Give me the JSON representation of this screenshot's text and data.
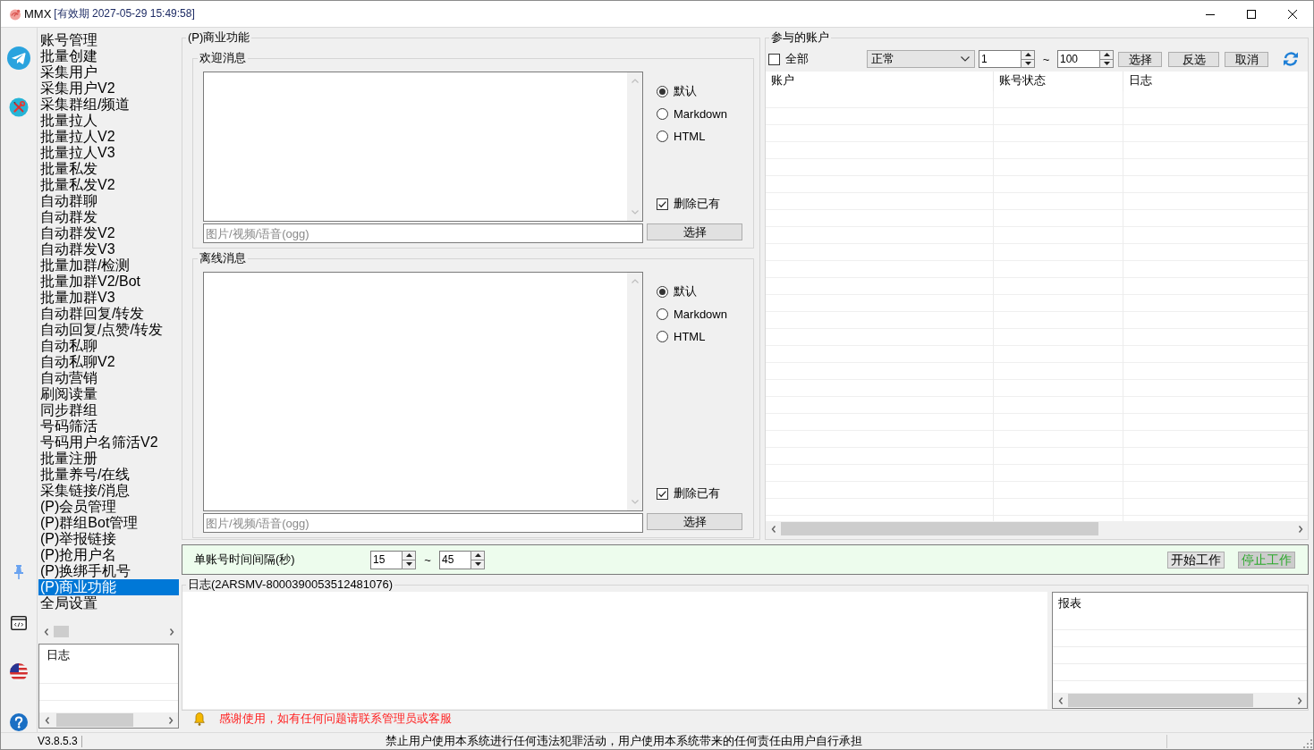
{
  "window": {
    "app_name": "MMX",
    "title": "[有效期 2027-05-29 15:49:58]"
  },
  "sidebar": {
    "items": [
      {
        "label": "账号管理",
        "selected": false
      },
      {
        "label": "批量创建",
        "selected": false
      },
      {
        "label": "采集用户",
        "selected": false
      },
      {
        "label": "采集用户V2",
        "selected": false
      },
      {
        "label": "采集群组/频道",
        "selected": false
      },
      {
        "label": "批量拉人",
        "selected": false
      },
      {
        "label": "批量拉人V2",
        "selected": false
      },
      {
        "label": "批量拉人V3",
        "selected": false
      },
      {
        "label": "批量私发",
        "selected": false
      },
      {
        "label": "批量私发V2",
        "selected": false
      },
      {
        "label": "自动群聊",
        "selected": false
      },
      {
        "label": "自动群发",
        "selected": false
      },
      {
        "label": "自动群发V2",
        "selected": false
      },
      {
        "label": "自动群发V3",
        "selected": false
      },
      {
        "label": "批量加群/检测",
        "selected": false
      },
      {
        "label": "批量加群V2/Bot",
        "selected": false
      },
      {
        "label": "批量加群V3",
        "selected": false
      },
      {
        "label": "自动群回复/转发",
        "selected": false
      },
      {
        "label": "自动回复/点赞/转发",
        "selected": false
      },
      {
        "label": "自动私聊",
        "selected": false
      },
      {
        "label": "自动私聊V2",
        "selected": false
      },
      {
        "label": "自动营销",
        "selected": false
      },
      {
        "label": "刷阅读量",
        "selected": false
      },
      {
        "label": "同步群组",
        "selected": false
      },
      {
        "label": "号码筛活",
        "selected": false
      },
      {
        "label": "号码用户名筛活V2",
        "selected": false
      },
      {
        "label": "批量注册",
        "selected": false
      },
      {
        "label": "批量养号/在线",
        "selected": false
      },
      {
        "label": "采集链接/消息",
        "selected": false
      },
      {
        "label": "(P)会员管理",
        "selected": false
      },
      {
        "label": "(P)群组Bot管理",
        "selected": false
      },
      {
        "label": "(P)举报链接",
        "selected": false
      },
      {
        "label": "(P)抢用户名",
        "selected": false
      },
      {
        "label": "(P)换绑手机号",
        "selected": false
      },
      {
        "label": "(P)商业功能",
        "selected": true
      },
      {
        "label": "全局设置",
        "selected": false
      }
    ],
    "log_table": {
      "columns": [
        "日志"
      ]
    }
  },
  "business_panel": {
    "title": "(P)商业功能",
    "sections": [
      {
        "title": "欢迎消息",
        "formats": [
          {
            "label": "默认",
            "selected": true
          },
          {
            "label": "Markdown",
            "selected": false
          },
          {
            "label": "HTML",
            "selected": false
          }
        ],
        "delete_existing": {
          "label": "删除已有",
          "checked": true
        },
        "media_field": {
          "placeholder": "图片/视频/语音(ogg)"
        },
        "choose_button": "选择"
      },
      {
        "title": "离线消息",
        "formats": [
          {
            "label": "默认",
            "selected": true
          },
          {
            "label": "Markdown",
            "selected": false
          },
          {
            "label": "HTML",
            "selected": false
          }
        ],
        "delete_existing": {
          "label": "删除已有",
          "checked": true
        },
        "media_field": {
          "placeholder": "图片/视频/语音(ogg)"
        },
        "choose_button": "选择"
      }
    ]
  },
  "accounts_panel": {
    "title": "参与的账户",
    "select_all": {
      "label": "全部",
      "checked": false
    },
    "status_filter": {
      "value": "正常"
    },
    "range_from": {
      "value": "1"
    },
    "range_separator": "~",
    "range_to": {
      "value": "100"
    },
    "buttons": [
      "选择",
      "反选",
      "取消"
    ],
    "table": {
      "columns": [
        "账户",
        "账号状态",
        "日志"
      ]
    }
  },
  "interval_bar": {
    "label": "单账号时间间隔(秒)",
    "min": {
      "value": "15"
    },
    "separator": "~",
    "max": {
      "value": "45"
    },
    "buttons": [
      {
        "label": "开始工作",
        "active": false
      },
      {
        "label": "停止工作",
        "active": true
      }
    ]
  },
  "log_panel": {
    "title": "日志(2ARSMV-8000390053512481076)",
    "report_table": {
      "columns": [
        "报表"
      ]
    }
  },
  "notice": "感谢使用，如有任何问题请联系管理员或客服",
  "status_bar": {
    "version": "V3.8.5.3",
    "message": "禁止用户使用本系统进行任何违法犯罪活动，用户使用本系统带来的任何责任由用户自行承担"
  }
}
